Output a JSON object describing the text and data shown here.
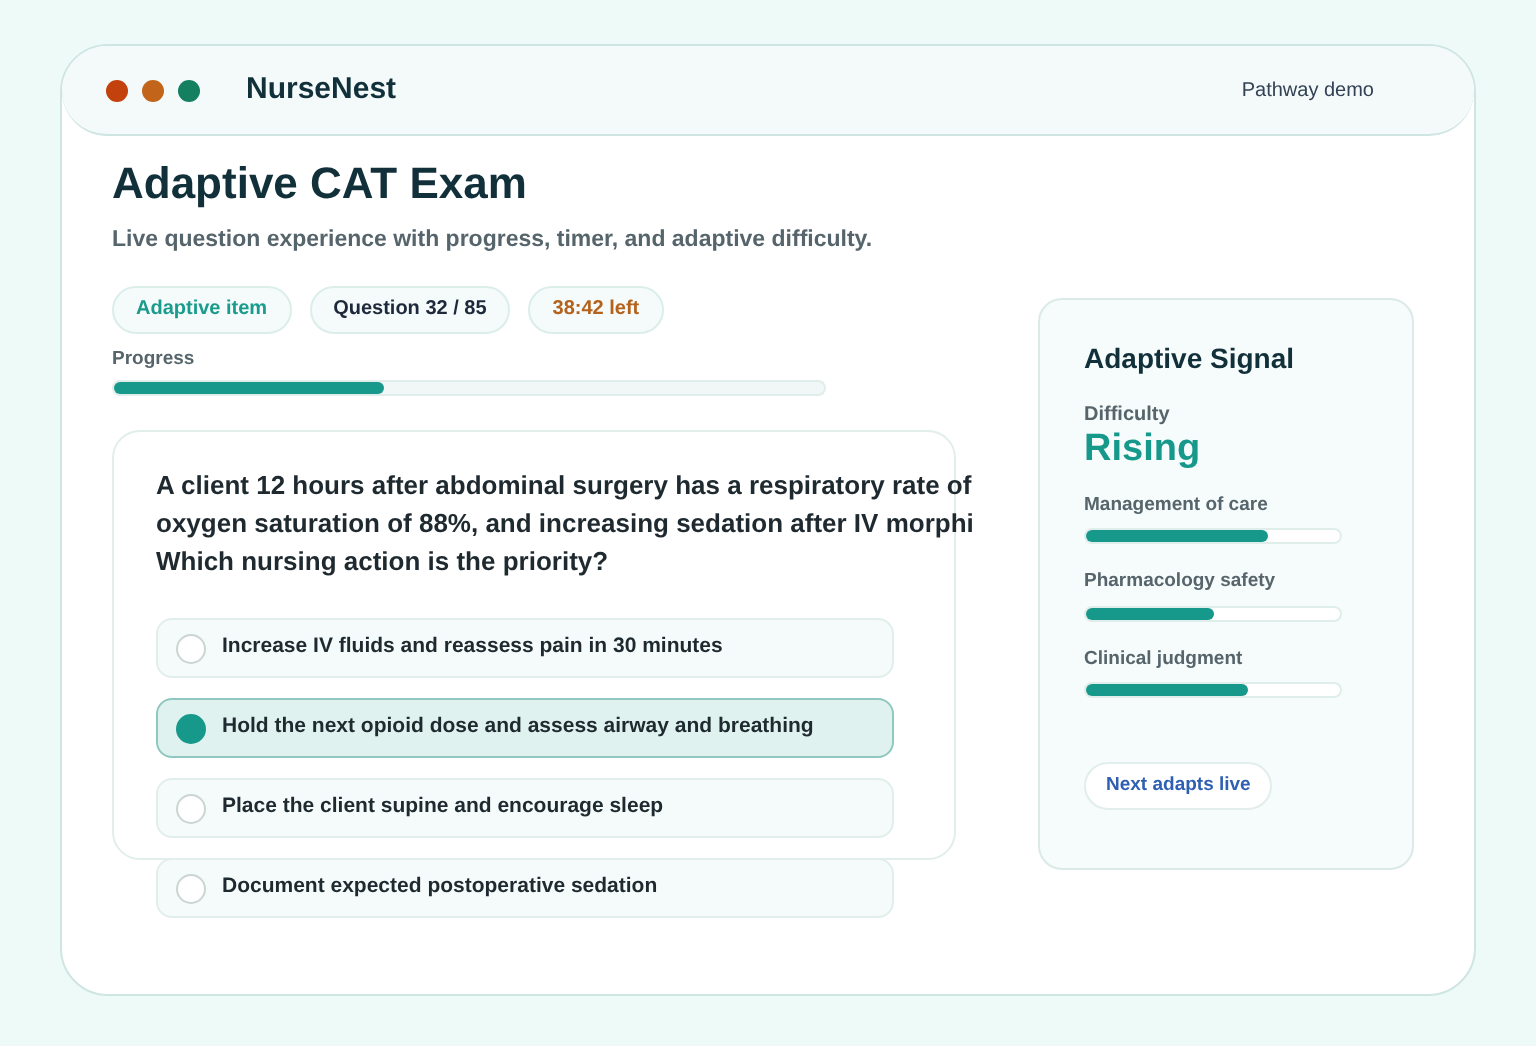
{
  "window": {
    "title": "NurseNest",
    "dots": [
      {
        "color": "#c2410c"
      },
      {
        "color": "#c2651a"
      },
      {
        "color": "#15805f"
      }
    ],
    "link": "Pathway demo"
  },
  "page": {
    "title": "Adaptive CAT Exam",
    "subtitle": "Live question experience with progress, timer, and adaptive difficulty."
  },
  "chips": [
    {
      "kind": "accent",
      "label": "Adaptive item"
    },
    {
      "kind": "plain",
      "label": "Question 32 / 85"
    },
    {
      "kind": "warn",
      "label": "38:42 left"
    }
  ],
  "progress": {
    "label": "Progress",
    "level": 0.38
  },
  "question": {
    "lines": [
      "A client 12 hours after abdominal surgery has a respiratory rate of",
      "oxygen saturation of 88%, and increasing sedation after IV morphi",
      "Which nursing action is the priority?"
    ],
    "options": [
      {
        "label": "Increase IV fluids and reassess pain in 30 minutes",
        "selected": false
      },
      {
        "label": "Hold the next opioid dose and assess airway and breathing",
        "selected": true
      },
      {
        "label": "Place the client supine and encourage sleep",
        "selected": false
      },
      {
        "label": "Document expected postoperative sedation",
        "selected": false
      }
    ]
  },
  "signal": {
    "title": "Adaptive Signal",
    "difficulty_label": "Difficulty",
    "difficulty": "Rising",
    "meters": [
      {
        "label": "Management of care",
        "level": 0.72
      },
      {
        "label": "Pharmacology safety",
        "level": 0.5
      },
      {
        "label": "Clinical judgment",
        "level": 0.64
      }
    ],
    "button": "Next adapts live"
  }
}
